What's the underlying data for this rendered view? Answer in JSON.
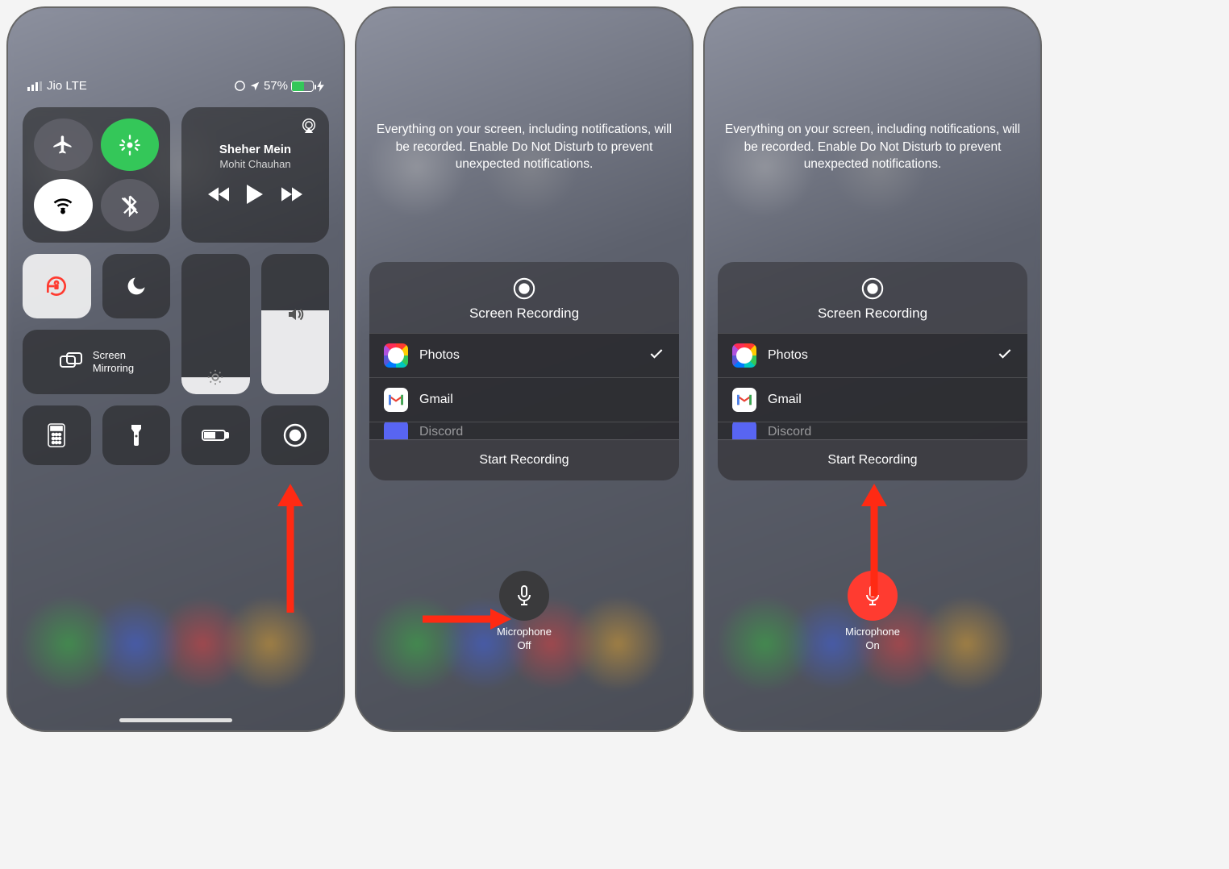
{
  "screen1": {
    "status": {
      "carrier": "Jio LTE",
      "battery_percent": "57%",
      "battery_fill": 57
    },
    "music": {
      "title": "Sheher Mein",
      "artist": "Mohit Chauhan"
    },
    "mirroring_label": "Screen\nMirroring",
    "brightness_percent": 12,
    "volume_percent": 60
  },
  "recording": {
    "description": "Everything on your screen, including notifications, will be recorded. Enable Do Not Disturb to prevent unexpected notifications.",
    "title": "Screen Recording",
    "apps": [
      {
        "name": "Photos",
        "selected": true,
        "icon": "photos"
      },
      {
        "name": "Gmail",
        "selected": false,
        "icon": "gmail"
      },
      {
        "name": "Discord",
        "selected": false,
        "icon": "discord",
        "partial": true
      }
    ],
    "start_label": "Start Recording",
    "mic_label_title": "Microphone"
  },
  "screen2": {
    "mic_state": "Off"
  },
  "screen3": {
    "mic_state": "On"
  },
  "annotation": {
    "arrow_color": "#ff2a13"
  }
}
